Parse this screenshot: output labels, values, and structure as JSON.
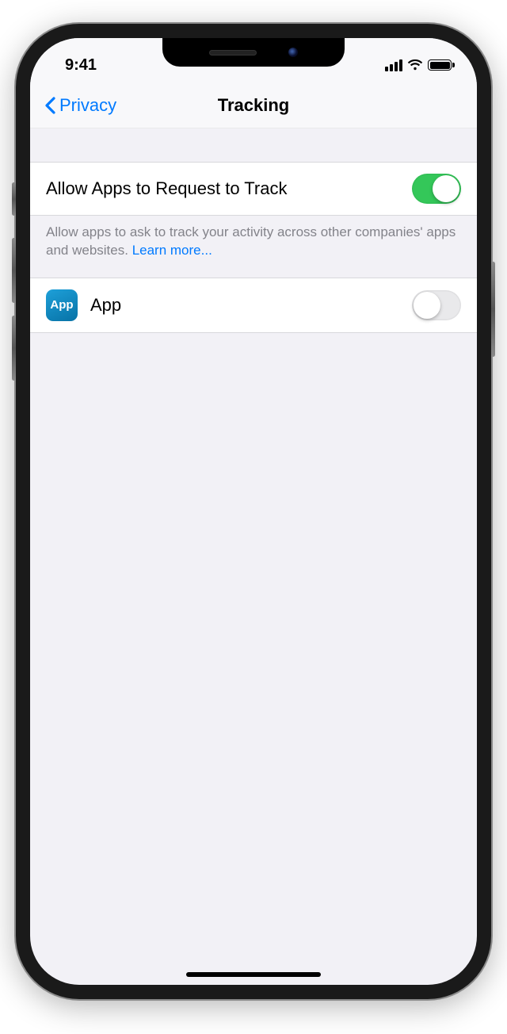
{
  "status": {
    "time": "9:41"
  },
  "nav": {
    "back_label": "Privacy",
    "title": "Tracking"
  },
  "tracking": {
    "allow_label": "Allow Apps to Request to Track",
    "allow_on": true,
    "footer": "Allow apps to ask to track your activity across other companies' apps and websites. ",
    "learn_more": "Learn more..."
  },
  "apps": [
    {
      "icon_text": "App",
      "name": "App",
      "on": false
    }
  ]
}
